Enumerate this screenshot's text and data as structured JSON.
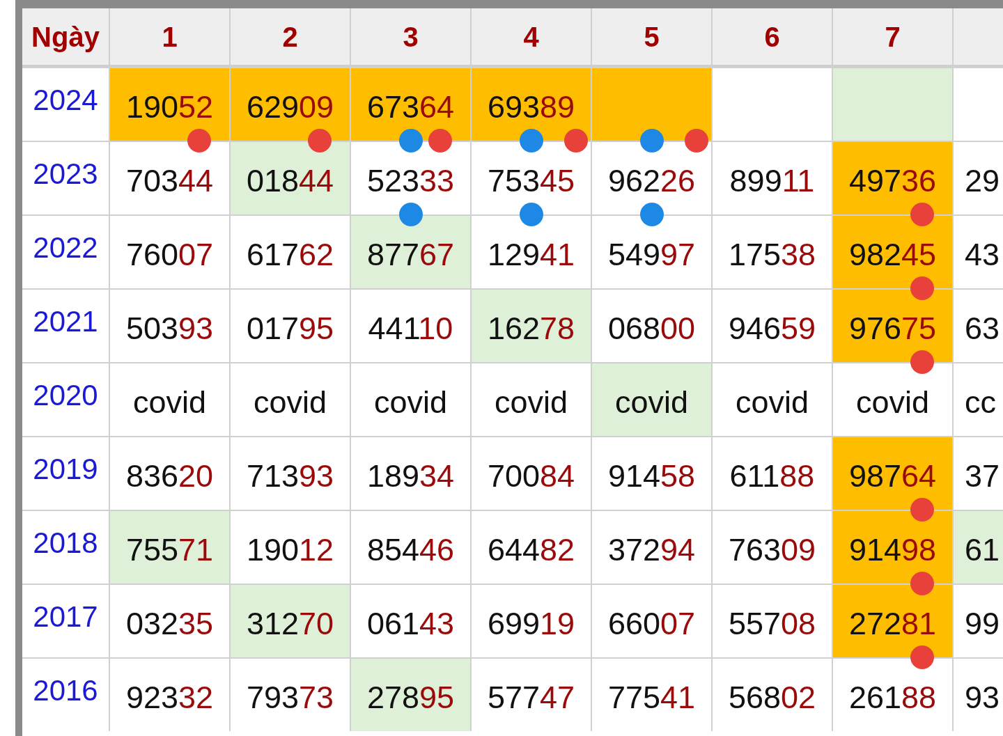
{
  "header": [
    "Ngày",
    "1",
    "2",
    "3",
    "4",
    "5",
    "6",
    "7"
  ],
  "rows": [
    {
      "year": "2024",
      "cells": [
        {
          "head": "190",
          "tail": "52",
          "color": "#ffbd00",
          "dots": [
            {
              "color": "#e8403a",
              "kind": "right"
            }
          ]
        },
        {
          "head": "629",
          "tail": "09",
          "color": "#ffbd00",
          "dots": [
            {
              "color": "#e8403a",
              "kind": "right"
            }
          ]
        },
        {
          "head": "673",
          "tail": "64",
          "color": "#ffbd00",
          "dots": [
            {
              "color": "#1e88e5",
              "kind": "center"
            },
            {
              "color": "#e8403a",
              "kind": "right"
            }
          ]
        },
        {
          "head": "693",
          "tail": "89",
          "color": "#ffbd00",
          "dots": [
            {
              "color": "#1e88e5",
              "kind": "center"
            },
            {
              "color": "#e8403a",
              "kind": "edge"
            }
          ]
        },
        {
          "color": "#ffbd00",
          "dots": [
            {
              "color": "#1e88e5",
              "kind": "center"
            },
            {
              "color": "#e8403a",
              "kind": "edge"
            }
          ]
        },
        {},
        {
          "color": "#dff0d8"
        },
        {}
      ]
    },
    {
      "year": "2023",
      "cells": [
        {
          "head": "703",
          "tail": "44"
        },
        {
          "head": "018",
          "tail": "44",
          "color": "#dff0d8"
        },
        {
          "head": "523",
          "tail": "33",
          "dots": [
            {
              "color": "#1e88e5",
              "kind": "center"
            }
          ]
        },
        {
          "head": "753",
          "tail": "45",
          "dots": [
            {
              "color": "#1e88e5",
              "kind": "center"
            }
          ]
        },
        {
          "head": "962",
          "tail": "26",
          "dots": [
            {
              "color": "#1e88e5",
              "kind": "center"
            }
          ]
        },
        {
          "head": "899",
          "tail": "11"
        },
        {
          "head": "497",
          "tail": "36",
          "color": "#ffbd00",
          "dots": [
            {
              "color": "#e8403a",
              "kind": "right"
            }
          ]
        },
        {
          "head": "29"
        }
      ]
    },
    {
      "year": "2022",
      "cells": [
        {
          "head": "760",
          "tail": "07"
        },
        {
          "head": "617",
          "tail": "62"
        },
        {
          "head": "877",
          "tail": "67",
          "color": "#dff0d8"
        },
        {
          "head": "129",
          "tail": "41"
        },
        {
          "head": "549",
          "tail": "97"
        },
        {
          "head": "175",
          "tail": "38"
        },
        {
          "head": "982",
          "tail": "45",
          "color": "#ffbd00",
          "dots": [
            {
              "color": "#e8403a",
              "kind": "right"
            }
          ]
        },
        {
          "head": "43"
        }
      ]
    },
    {
      "year": "2021",
      "cells": [
        {
          "head": "503",
          "tail": "93"
        },
        {
          "head": "017",
          "tail": "95"
        },
        {
          "head": "441",
          "tail": "10"
        },
        {
          "head": "162",
          "tail": "78",
          "color": "#dff0d8"
        },
        {
          "head": "068",
          "tail": "00"
        },
        {
          "head": "946",
          "tail": "59"
        },
        {
          "head": "976",
          "tail": "75",
          "color": "#ffbd00",
          "dots": [
            {
              "color": "#e8403a",
              "kind": "right"
            }
          ]
        },
        {
          "head": "63"
        }
      ]
    },
    {
      "year": "2020",
      "cells": [
        {
          "head": "covid"
        },
        {
          "head": "covid"
        },
        {
          "head": "covid"
        },
        {
          "head": "covid"
        },
        {
          "head": "covid",
          "color": "#dff0d8"
        },
        {
          "head": "covid"
        },
        {
          "head": "covid"
        },
        {
          "head": "cc"
        }
      ]
    },
    {
      "year": "2019",
      "cells": [
        {
          "head": "836",
          "tail": "20"
        },
        {
          "head": "713",
          "tail": "93"
        },
        {
          "head": "189",
          "tail": "34"
        },
        {
          "head": "700",
          "tail": "84"
        },
        {
          "head": "914",
          "tail": "58"
        },
        {
          "head": "611",
          "tail": "88"
        },
        {
          "head": "987",
          "tail": "64",
          "color": "#ffbd00",
          "dots": [
            {
              "color": "#e8403a",
              "kind": "right"
            }
          ]
        },
        {
          "head": "37"
        }
      ]
    },
    {
      "year": "2018",
      "cells": [
        {
          "head": "755",
          "tail": "71",
          "color": "#dff0d8"
        },
        {
          "head": "190",
          "tail": "12"
        },
        {
          "head": "854",
          "tail": "46"
        },
        {
          "head": "644",
          "tail": "82"
        },
        {
          "head": "372",
          "tail": "94"
        },
        {
          "head": "763",
          "tail": "09"
        },
        {
          "head": "914",
          "tail": "98",
          "color": "#ffbd00",
          "dots": [
            {
              "color": "#e8403a",
              "kind": "right"
            }
          ]
        },
        {
          "head": "61",
          "color": "#dff0d8"
        }
      ]
    },
    {
      "year": "2017",
      "cells": [
        {
          "head": "032",
          "tail": "35"
        },
        {
          "head": "312",
          "tail": "70",
          "color": "#dff0d8"
        },
        {
          "head": "061",
          "tail": "43"
        },
        {
          "head": "699",
          "tail": "19"
        },
        {
          "head": "660",
          "tail": "07"
        },
        {
          "head": "557",
          "tail": "08"
        },
        {
          "head": "272",
          "tail": "81",
          "color": "#ffbd00",
          "dots": [
            {
              "color": "#e8403a",
              "kind": "right"
            }
          ]
        },
        {
          "head": "99"
        }
      ]
    },
    {
      "year": "2016",
      "cells": [
        {
          "head": "923",
          "tail": "32"
        },
        {
          "head": "793",
          "tail": "73"
        },
        {
          "head": "278",
          "tail": "95",
          "color": "#dff0d8"
        },
        {
          "head": "577",
          "tail": "47"
        },
        {
          "head": "775",
          "tail": "41"
        },
        {
          "head": "568",
          "tail": "02"
        },
        {
          "head": "261",
          "tail": "88"
        },
        {
          "head": "93"
        }
      ]
    }
  ]
}
